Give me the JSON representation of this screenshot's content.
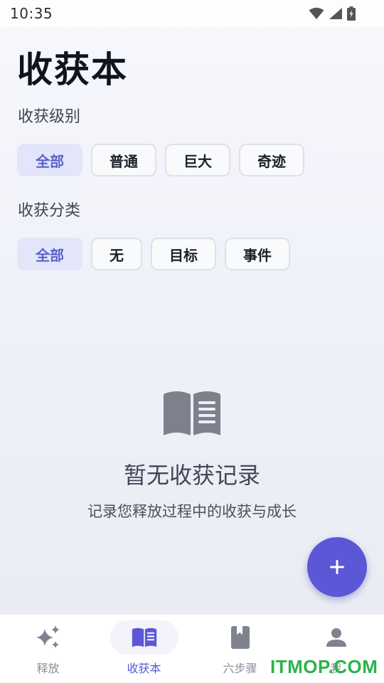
{
  "status_bar": {
    "time": "10:35"
  },
  "page_title": "收获本",
  "level_section": {
    "label": "收获级别",
    "chips": [
      {
        "label": "全部",
        "selected": true
      },
      {
        "label": "普通",
        "selected": false
      },
      {
        "label": "巨大",
        "selected": false
      },
      {
        "label": "奇迹",
        "selected": false
      }
    ]
  },
  "category_section": {
    "label": "收获分类",
    "chips": [
      {
        "label": "全部",
        "selected": true
      },
      {
        "label": "无",
        "selected": false
      },
      {
        "label": "目标",
        "selected": false
      },
      {
        "label": "事件",
        "selected": false
      }
    ]
  },
  "empty_state": {
    "icon": "book-open-icon",
    "title": "暂无收获记录",
    "subtitle": "记录您释放过程中的收获与成长"
  },
  "fab": {
    "icon": "plus-icon"
  },
  "bottom_nav": {
    "items": [
      {
        "label": "释放",
        "icon": "sparkle-icon",
        "active": false
      },
      {
        "label": "收获本",
        "icon": "book-open-icon",
        "active": true
      },
      {
        "label": "六步骤",
        "icon": "book-icon",
        "active": false
      },
      {
        "label": "我",
        "icon": "person-icon",
        "active": false
      }
    ]
  },
  "watermark": "ITMOP.COM",
  "colors": {
    "accent": "#5b57d6",
    "chip_selected_bg": "#e3e6fa",
    "chip_selected_text": "#5a63c9"
  }
}
